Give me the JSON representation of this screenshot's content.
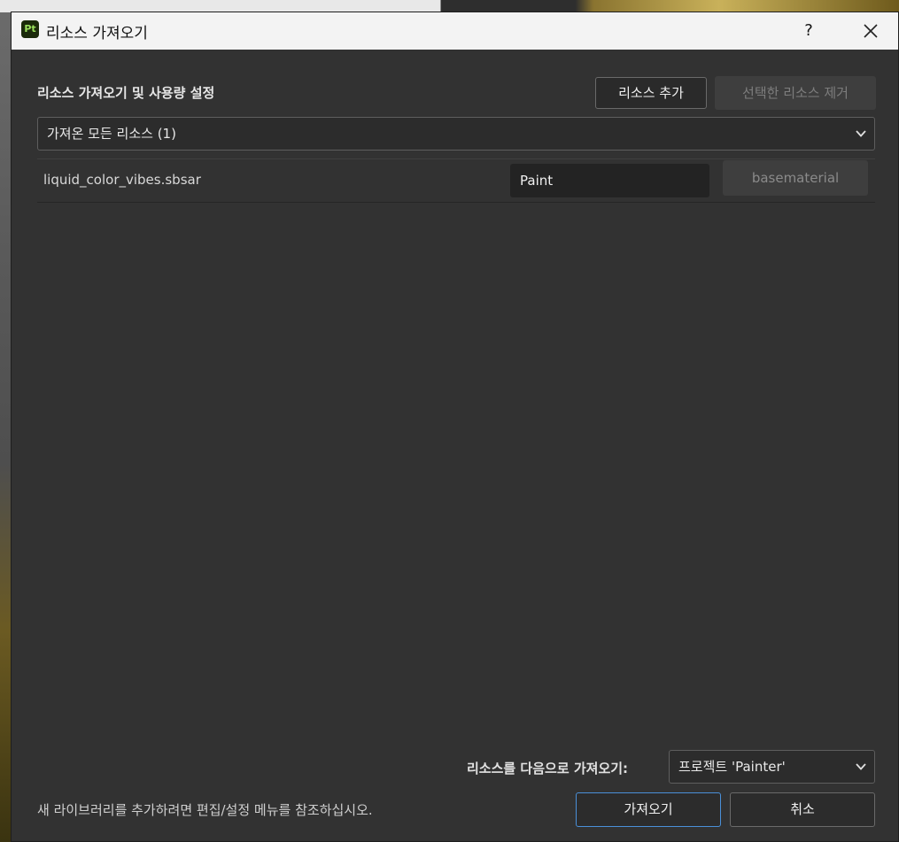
{
  "window": {
    "app_icon": "Pt",
    "title": "리소스 가져오기",
    "help": "?"
  },
  "section_title": "리소스 가져오기 및 사용량 설정",
  "buttons": {
    "add_resource": "리소스 추가",
    "remove_selected": "선택한 리소스 제거",
    "import": "가져오기",
    "cancel": "취소"
  },
  "filter": {
    "selected": "가져온 모든 리소스 (1)"
  },
  "resources": [
    {
      "name": "liquid_color_vibes.sbsar",
      "usage": "Paint",
      "shader": "basematerial"
    }
  ],
  "import_destination": {
    "label": "리소스를 다음으로 가져오기:",
    "selected": "프로젝트 'Painter'"
  },
  "hint": "새 라이브러리를 추가하려면 편집/설정 메뉴를 참조하십시오.",
  "colors": {
    "dialog_bg": "#323232",
    "titlebar_bg": "#f3f3f3",
    "accent_border": "#4a90d9",
    "app_icon_bg": "#1b2a0a",
    "app_icon_fg": "#9be15d"
  }
}
